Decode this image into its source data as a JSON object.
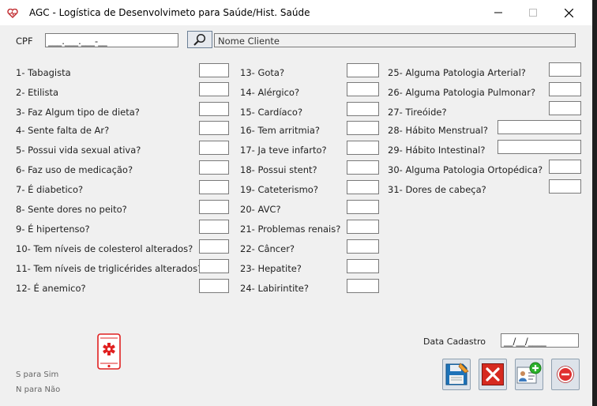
{
  "window": {
    "title": "AGC - Logística de Desenvolvimeto para Saúde/Hist. Saúde"
  },
  "cpf": {
    "label": "CPF",
    "mask": "___.___.___-__"
  },
  "client": {
    "name_label": "Nome Cliente"
  },
  "questions": [
    "1- Tabagista",
    "2- Etilista",
    "3- Faz Algum tipo de dieta?",
    "4- Sente falta de Ar?",
    "5- Possui vida sexual ativa?",
    "6- Faz uso de medicação?",
    "7- É diabetico?",
    "8- Sente dores no peito?",
    "9- É hipertenso?",
    "10- Tem níveis de colesterol alterados?",
    "11- Tem níveis de triglicérides alterados?",
    "12- É anemico?",
    "13- Gota?",
    "14- Alérgico?",
    "15- Cardíaco?",
    "16- Tem arritmia?",
    "17- Ja teve infarto?",
    "18- Possui stent?",
    "19- Cateterismo?",
    "20- AVC?",
    "21- Problemas renais?",
    "22- Câncer?",
    "23- Hepatite?",
    "24- Labirintite?",
    "25- Alguma Patologia Arterial?",
    "26- Alguma Patologia Pulmonar?",
    "27- Tireóide?",
    "28- Hábito Menstrual?",
    "29- Hábito Intestinal?",
    "30- Alguma Patologia Ortopédica?",
    "31- Dores de cabeça?"
  ],
  "registration": {
    "label": "Data Cadastro",
    "mask": "__/__/____"
  },
  "legend": {
    "yes": "S para Sim",
    "no": "N para Não"
  },
  "icons": {
    "app": "app-logo-icon",
    "search": "magnifier-icon",
    "phone": "mobile-health-icon",
    "save": "save-icon",
    "delete": "delete-icon",
    "add_patient": "add-patient-icon",
    "close": "close-icon"
  },
  "colors": {
    "accent_red": "#e02020",
    "save_blue": "#1e73b8",
    "add_green": "#2bb12b"
  }
}
